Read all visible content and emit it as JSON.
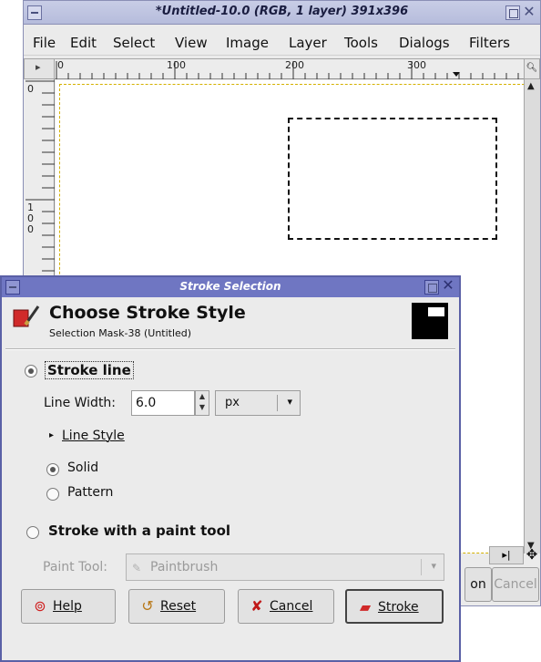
{
  "image_window": {
    "title": "*Untitled-10.0 (RGB, 1 layer) 391x396",
    "menu": [
      "File",
      "Edit",
      "Select",
      "View",
      "Image",
      "Layer",
      "Tools",
      "Dialogs",
      "Filters"
    ],
    "hruler_labels": [
      "0",
      "100",
      "200",
      "300"
    ],
    "vruler_labels": [
      "0",
      "1",
      "0",
      "0"
    ],
    "hidden_buttons": {
      "ok_partial": "on",
      "cancel": "Cancel"
    }
  },
  "dialog": {
    "title": "Stroke Selection",
    "heading": "Choose Stroke Style",
    "subheading": "Selection Mask-38 (Untitled)",
    "stroke_line": {
      "label": "Stroke line",
      "selected": true,
      "line_width_label": "Line Width:",
      "line_width_value": "6.0",
      "unit": "px",
      "line_style_label": "Line Style",
      "solid_label": "Solid",
      "pattern_label": "Pattern",
      "solid_selected": true
    },
    "paint_tool": {
      "label": "Stroke with a paint tool",
      "selected": false,
      "tool_label": "Paint Tool:",
      "tool_value": "Paintbrush"
    },
    "buttons": {
      "help": "Help",
      "reset": "Reset",
      "cancel": "Cancel",
      "stroke": "Stroke"
    }
  },
  "colors": {
    "dialog_titlebar": "#6f76c2",
    "window_titlebar": "#c0c6e2",
    "selection_border": "#d4b100"
  }
}
